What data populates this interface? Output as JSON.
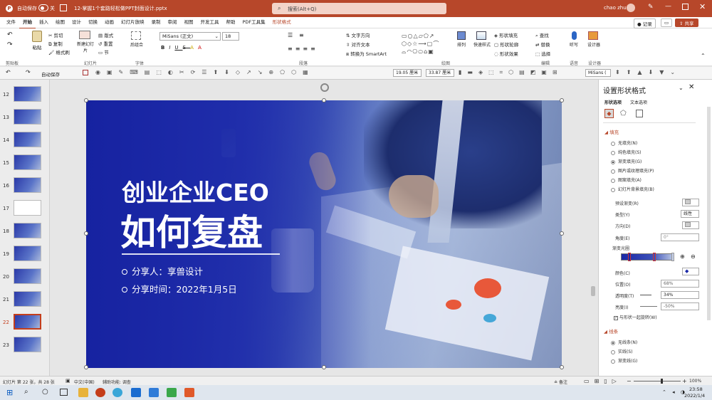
{
  "titlebar": {
    "autosave": "自动保存",
    "toggle_state": "关",
    "filename": "12-掌握1个套路轻松做PPT封面设计.pptx",
    "search_placeholder": "搜索(Alt+Q)",
    "user": "chao zhu"
  },
  "menu": {
    "tabs": [
      "文件",
      "开始",
      "插入",
      "绘图",
      "设计",
      "切换",
      "动画",
      "幻灯片放映",
      "录制",
      "审阅",
      "视图",
      "开发工具",
      "帮助",
      "PDF工具集",
      "形状格式"
    ],
    "active": "开始",
    "record": "记录",
    "share": "共享"
  },
  "ribbon": {
    "paste": "粘贴",
    "cut": "剪切",
    "copy": "复制",
    "format_painter": "格式刷",
    "new_slide": "新建幻灯片",
    "layout": "版式",
    "reset": "重置",
    "section": "节",
    "ungroup": "后组合",
    "font_name": "MiSans (正文)",
    "font_size": "18",
    "text_direction": "文字方向",
    "align_text": "对齐文本",
    "smartart": "转换为 SmartArt",
    "arrange": "排列",
    "quick_styles": "快速样式",
    "shape_fill": "形状填充",
    "shape_outline": "形状轮廓",
    "shape_effects": "形状效果",
    "find": "查找",
    "replace": "替换",
    "select": "选择",
    "dictate": "听写",
    "designer": "设计器",
    "groups": [
      "剪贴板",
      "幻灯片",
      "字体",
      "段落",
      "绘图",
      "编辑",
      "语音",
      "设计器"
    ]
  },
  "qat": {
    "autosave": "自动保存",
    "width_value": "19.05 厘米",
    "height_value": "33.87 厘米",
    "font_name": "MiSans ("
  },
  "slides": {
    "numbers": [
      "12",
      "13",
      "14",
      "15",
      "16",
      "17",
      "18",
      "19",
      "20",
      "21",
      "22",
      "23"
    ],
    "selected": "22"
  },
  "slide": {
    "title_line1": "创业企业CEO",
    "title_line2": "如何复盘",
    "sharer": "分享人：享兽设计",
    "share_time": "分享时间：2022年1月5日"
  },
  "pane": {
    "title": "设置形状格式",
    "tab_shape": "形状选项",
    "tab_text": "文本选项",
    "section_fill": "填充",
    "fill_options": [
      "无填充(N)",
      "纯色填充(S)",
      "渐变填充(G)",
      "图片或纹理填充(P)",
      "图案填充(A)",
      "幻灯片背景填充(B)"
    ],
    "fill_selected": 2,
    "preset": "预设渐变(R)",
    "type_label": "类型(Y)",
    "type_value": "线性",
    "direction": "方向(D)",
    "angle_label": "角度(E)",
    "angle_value": "0°",
    "gradient_stops": "渐变光圈",
    "color": "颜色(C)",
    "position_label": "位置(O)",
    "position_value": "68%",
    "transparency_label": "透明度(T)",
    "transparency_value": "34%",
    "brightness_label": "亮度(I)",
    "brightness_value": "-50%",
    "rotate_with_shape": "与形状一起旋转(W)",
    "section_line": "线条",
    "line_options": [
      "无线条(N)",
      "实线(S)",
      "渐变线(G)"
    ],
    "line_selected": 0
  },
  "status": {
    "slide_info": "幻灯片 第 22 张，共 28 张",
    "language": "中文(中国)",
    "accessibility": "辅助功能: 调查",
    "notes": "备注",
    "zoom": "100%"
  },
  "taskbar": {
    "time": "23:58",
    "date": "2022/1/4"
  },
  "colors": {
    "accent": "#b7472a",
    "slide_blue": "#1f2fa0"
  }
}
